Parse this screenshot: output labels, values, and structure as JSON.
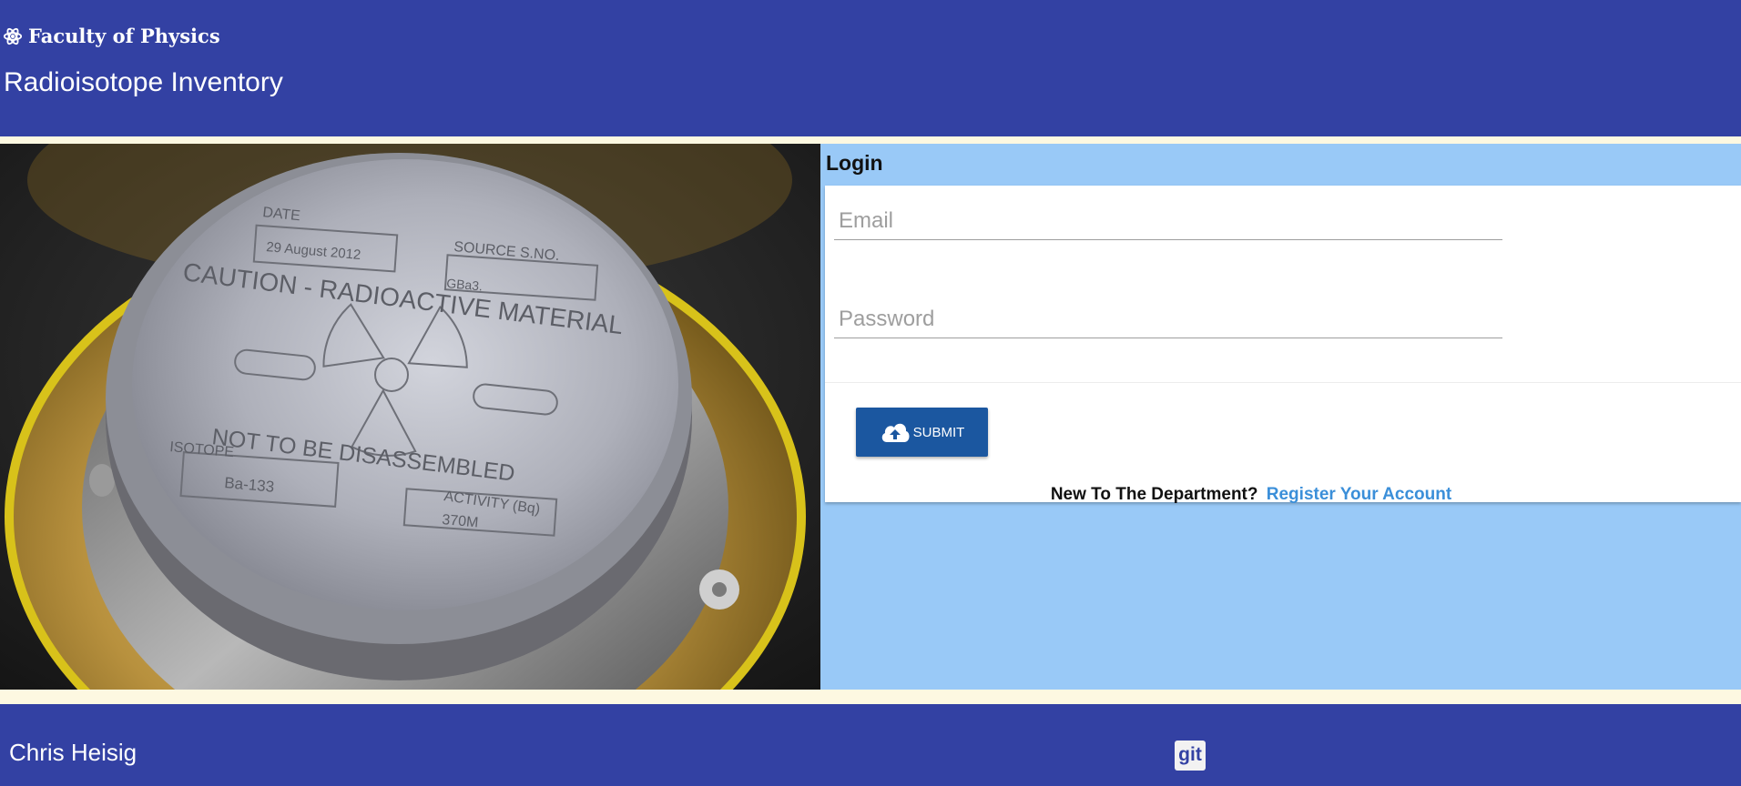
{
  "header": {
    "faculty_name": "Faculty of Physics",
    "faculty_icon": "atom-icon",
    "app_title": "Radioisotope Inventory"
  },
  "hero_image": {
    "plate": {
      "date_label": "DATE",
      "date_value": "29 August 2012",
      "source_label": "SOURCE S.NO.",
      "source_value": "GBa3.",
      "caution_text": "CAUTION - RADIOACTIVE MATERIAL",
      "warning_text": "NOT TO BE DISASSEMBLED",
      "isotope_label": "ISOTOPE",
      "isotope_value": "Ba-133",
      "activity_label": "ACTIVITY (Bq)",
      "activity_value": "370M"
    }
  },
  "login": {
    "title": "Login",
    "email_placeholder": "Email",
    "email_value": "",
    "password_placeholder": "Password",
    "password_value": "",
    "submit_label": "SUBMIT",
    "submit_icon": "cloud-upload-icon",
    "register_question": "New To The Department?",
    "register_link": "Register Your Account"
  },
  "footer": {
    "author": "Chris Heisig",
    "git_label": "git"
  },
  "colors": {
    "header_bg": "#3341a3",
    "stripe": "#fdf8e1",
    "panel_bg": "#99c9f7",
    "button_bg": "#1b57a0",
    "link": "#3b8fd9"
  }
}
